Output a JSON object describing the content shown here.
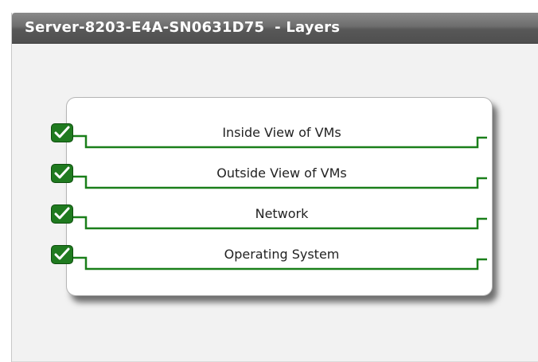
{
  "window": {
    "title": "Server-8203-E4A-SN0631D75  - Layers"
  },
  "layers": [
    {
      "label": "Inside View of VMs",
      "checked": true
    },
    {
      "label": "Outside View of VMs",
      "checked": true
    },
    {
      "label": "Network",
      "checked": true
    },
    {
      "label": "Operating System",
      "checked": true
    }
  ],
  "colors": {
    "accent_green": "#1f7a1f",
    "line_green": "#1a7f1a",
    "titlebar": "#5f5f5f"
  },
  "icons": {
    "checkbox": "checkmark-icon"
  }
}
